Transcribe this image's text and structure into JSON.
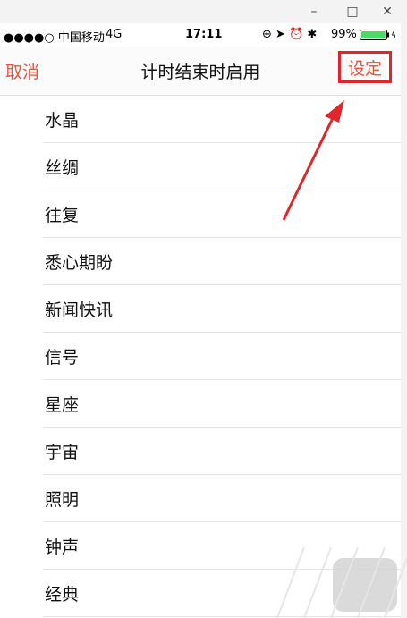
{
  "window": {
    "minimize_icon": "minimize-icon",
    "maximize_icon": "maximize-icon",
    "close_icon": "close-icon",
    "minimize": "–",
    "maximize": "□",
    "close": "✕"
  },
  "status": {
    "carrier": "●●●●○ 中国移动",
    "network": "4G",
    "time": "17:11",
    "icons": "⊕ ➤ ⏰ ✱",
    "battery_percent": "99%",
    "battery_level": 0.99,
    "battery_color": "#4cd964"
  },
  "nav": {
    "cancel": "取消",
    "title": "计时结束时启用",
    "set": "设定",
    "accent_color": "#e9513e",
    "highlight_color": "#e0262b"
  },
  "list": {
    "items": [
      "水晶",
      "丝绸",
      "往复",
      "悉心期盼",
      "新闻快讯",
      "信号",
      "星座",
      "宇宙",
      "照明",
      "钟声",
      "经典"
    ]
  }
}
